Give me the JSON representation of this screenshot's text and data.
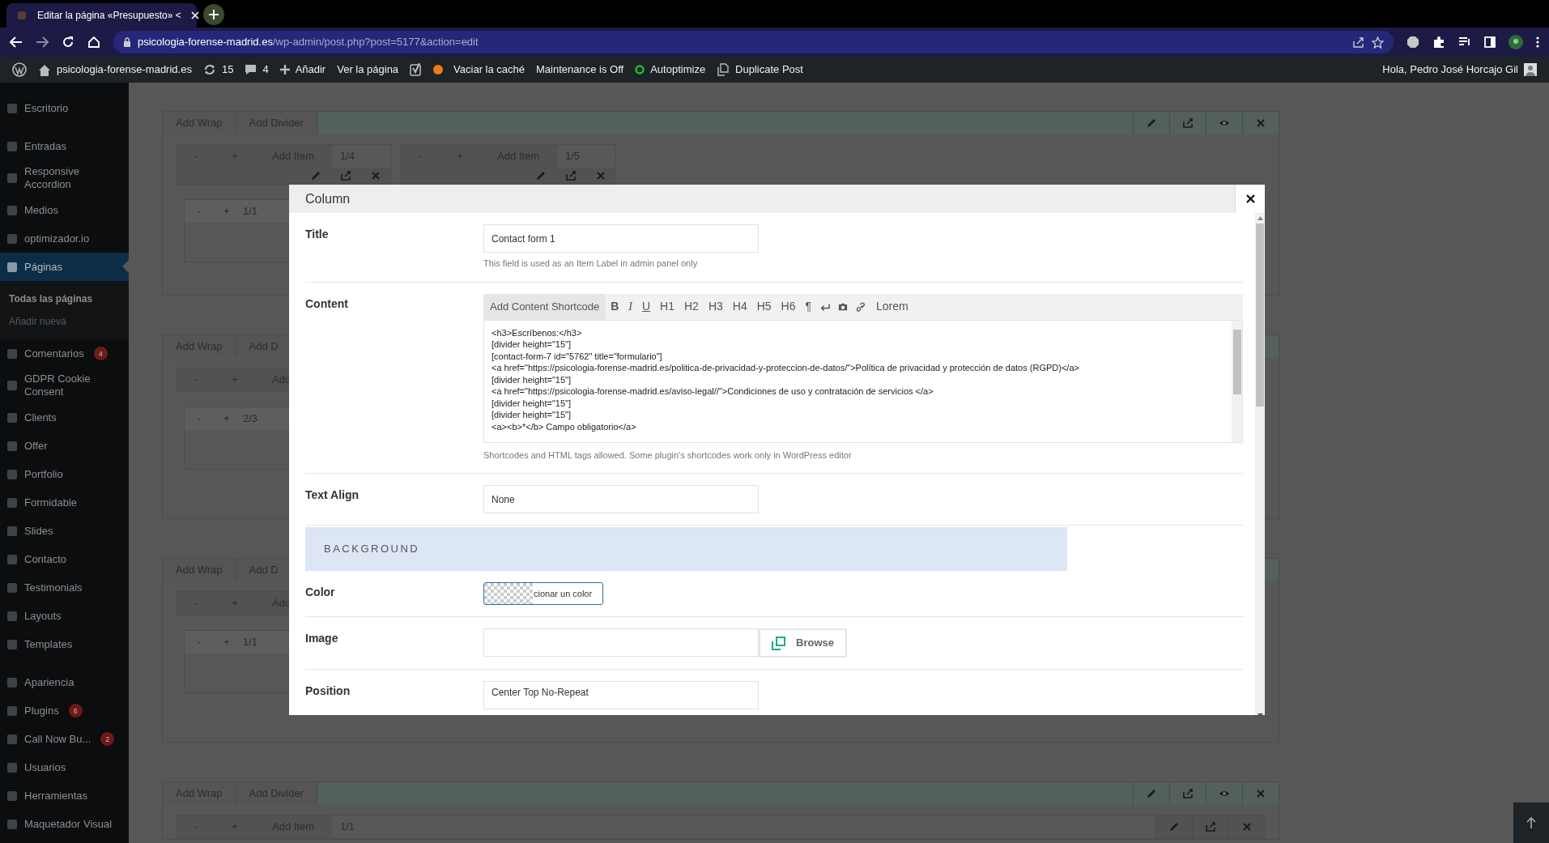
{
  "browser": {
    "tab_title": "Editar la página «Presupuesto» <",
    "url_host": "psicologia-forense-madrid.es",
    "url_path": "/wp-admin/post.php?post=5177&action=edit"
  },
  "admin_bar": {
    "site": "psicologia-forense-madrid.es",
    "updates": "15",
    "comments": "4",
    "new": "Añadir",
    "view": "Ver la página",
    "cache": "Vaciar la caché",
    "maintenance": "Maintenance is Off",
    "autoptimize": "Autoptimize",
    "duplicate": "Duplicate Post",
    "greeting": "Hola, Pedro José Horcajo Gil"
  },
  "sidebar": {
    "groups": [
      {
        "items": [
          {
            "label": "Escritorio",
            "selected": false
          }
        ]
      },
      {
        "items": [
          {
            "label": "Entradas",
            "selected": false
          },
          {
            "label": "Responsive Accordion",
            "selected": false
          },
          {
            "label": "Medios",
            "selected": false
          },
          {
            "label": "optimizador.io",
            "selected": false
          },
          {
            "label": "Páginas",
            "selected": true,
            "children": [
              {
                "label": "Todas las páginas",
                "selected": true
              },
              {
                "label": "Añadir nueva",
                "selected": false
              }
            ]
          },
          {
            "label": "Comentarios",
            "selected": false,
            "badge": "4"
          },
          {
            "label": "GDPR Cookie Consent",
            "selected": false
          },
          {
            "label": "Clients",
            "selected": false
          },
          {
            "label": "Offer",
            "selected": false
          },
          {
            "label": "Portfolio",
            "selected": false
          },
          {
            "label": "Formidable",
            "selected": false
          },
          {
            "label": "Slides",
            "selected": false
          },
          {
            "label": "Contacto",
            "selected": false
          },
          {
            "label": "Testimonials",
            "selected": false
          },
          {
            "label": "Layouts",
            "selected": false
          },
          {
            "label": "Templates",
            "selected": false
          }
        ]
      },
      {
        "items": [
          {
            "label": "Apariencia",
            "selected": false
          },
          {
            "label": "Plugins",
            "selected": false,
            "badge": "6"
          },
          {
            "label": "Call Now Bu...",
            "selected": false,
            "badge": "2"
          },
          {
            "label": "Usuarios",
            "selected": false
          },
          {
            "label": "Herramientas",
            "selected": false
          },
          {
            "label": "Maquetador Visual",
            "selected": false
          }
        ]
      }
    ]
  },
  "sections": [
    {
      "buttons": [
        "Add Wrap",
        "Add Divider"
      ],
      "actions_visible": true,
      "columns": [
        {
          "buttons": [
            "-",
            "+",
            "Add Item"
          ],
          "size": "1/4"
        },
        {
          "buttons": [
            "-",
            "+",
            "Add Item"
          ],
          "size": "1/5"
        }
      ],
      "items": [
        {
          "buttons": [
            "-",
            "+"
          ],
          "size": "1/1"
        }
      ]
    },
    {
      "buttons": [
        "Add Wrap",
        "Add D"
      ],
      "columns": [
        {
          "buttons": [
            "-",
            "+",
            "Add"
          ]
        }
      ],
      "items": [
        {
          "buttons": [
            "-",
            "+"
          ],
          "size": "2/3"
        }
      ]
    },
    {
      "buttons": [
        "Add Wrap",
        "Add D"
      ],
      "columns": [
        {
          "buttons": [
            "-",
            "+",
            "Add"
          ]
        }
      ],
      "items": [
        {
          "buttons": [
            "-",
            "+"
          ],
          "size": "1/1"
        }
      ]
    },
    {
      "buttons": [
        "Add Wrap",
        "Add Divider"
      ],
      "actions_visible": true,
      "columns": [
        {
          "buttons": [
            "-",
            "+",
            "Add Item"
          ],
          "size": "1/1"
        }
      ]
    }
  ],
  "modal": {
    "title": "Column",
    "title_field": {
      "label": "Title",
      "value": "Contact form 1",
      "help": "This field is used as an Item Label in admin panel only"
    },
    "content_field": {
      "label": "Content",
      "shortcode_button": "Add Content Shortcode",
      "format_buttons": [
        "B",
        "I",
        "U",
        "H1",
        "H2",
        "H3",
        "H4",
        "H5",
        "H6",
        "¶"
      ],
      "extra_button": "Lorem",
      "value": "<h3>Escríbenos:</h3>\n[divider height=\"15\"]\n[contact-form-7 id=\"5762\" title=\"formulario\"]\n<a href=\"https://psicologia-forense-madrid.es/politica-de-privacidad-y-proteccion-de-datos/\">Política de privacidad y protección de datos (RGPD)</a>\n[divider height=\"15\"]\n<a href=\"https://psicologia-forense-madrid.es/aviso-legal//\">Condiciones de uso y contratación de servicios </a>\n[divider height=\"15\"]\n[divider height=\"15\"]\n<a><b>*</b> Campo obligatorio</a>",
      "help": "Shortcodes and HTML tags allowed. Some plugin's shortcodes work only in WordPress editor"
    },
    "align_field": {
      "label": "Text Align",
      "value": "None"
    },
    "section_heading": "BACKGROUND",
    "color_field": {
      "label": "Color",
      "button": "cionar un color"
    },
    "image_field": {
      "label": "Image",
      "button": "Browse"
    },
    "position_field": {
      "label": "Position",
      "value": "Center Top No-Repeat"
    }
  }
}
